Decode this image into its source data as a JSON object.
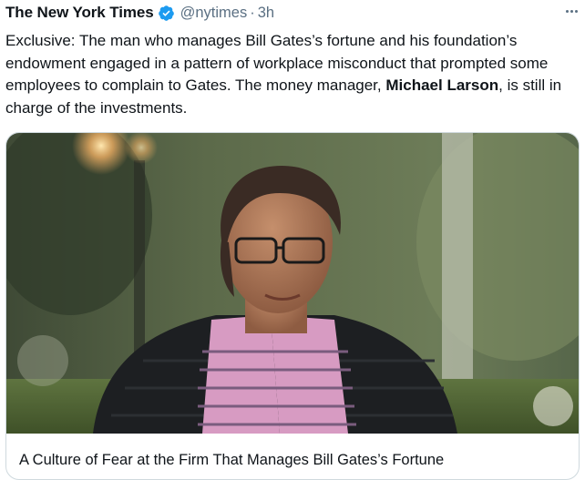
{
  "tweet": {
    "author_name": "The New York Times",
    "handle": "@nytimes",
    "separator": "·",
    "time": "3h",
    "text": {
      "part1": "Exclusive: The man who manages Bill Gates’s fortune and his foundation’s endowment engaged in a pattern of workplace misconduct that prompted some employees to complain to Gates. The money manager, ",
      "bold": "Michael Larson",
      "part2": ", is still in charge of the investments."
    }
  },
  "card": {
    "title": "A Culture of Fear at the Firm That Manages Bill Gates’s Fortune"
  },
  "colors": {
    "verified": "#1d9bf0",
    "secondary_text": "#5b7083",
    "card_border": "#cfd9de"
  }
}
